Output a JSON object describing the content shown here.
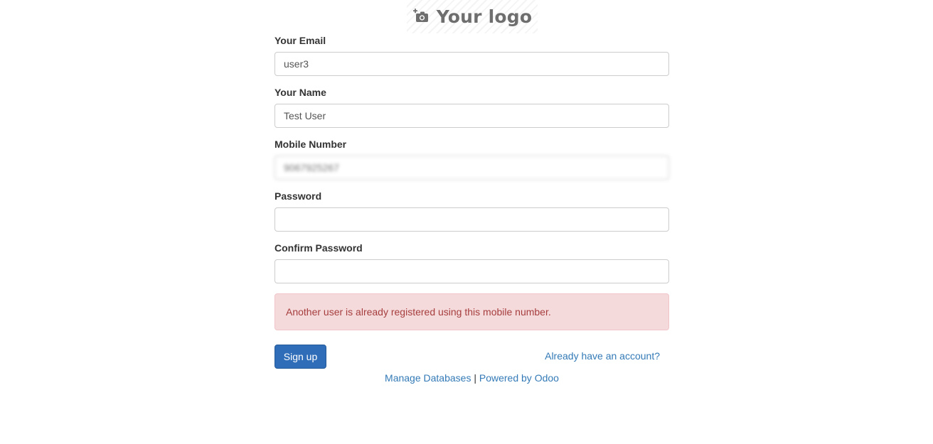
{
  "logo": {
    "text": "Your logo",
    "icon": "camera-plus-icon"
  },
  "form": {
    "email": {
      "label": "Your Email",
      "value": "user3"
    },
    "name": {
      "label": "Your Name",
      "value": "Test User"
    },
    "mobile": {
      "label": "Mobile Number",
      "value": "9067925267"
    },
    "password": {
      "label": "Password",
      "value": ""
    },
    "confirm_password": {
      "label": "Confirm Password",
      "value": ""
    }
  },
  "alert": {
    "message": "Another user is already registered using this mobile number."
  },
  "actions": {
    "signup_label": "Sign up",
    "login_link": "Already have an account?"
  },
  "footer": {
    "manage_databases": "Manage Databases",
    "separator": "|",
    "powered_by": "Powered by Odoo"
  },
  "colors": {
    "primary": "#2f6db8",
    "link": "#337ab7",
    "alert_bg": "#f5dadc",
    "alert_text": "#a63e3e"
  }
}
